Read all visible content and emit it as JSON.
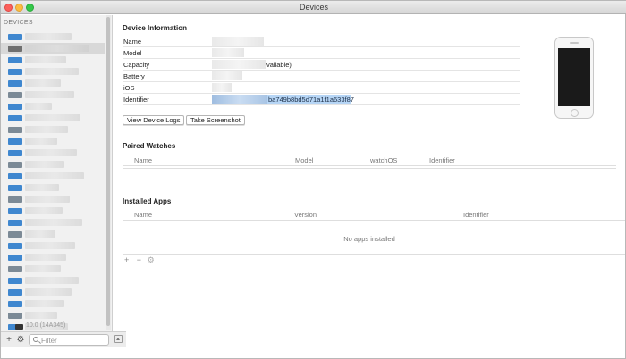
{
  "window": {
    "title": "Devices"
  },
  "sidebar": {
    "header": "DEVICES",
    "last_device_text": "10.0 (14A345)",
    "filter_placeholder": "Filter",
    "add_symbol": "+",
    "settings_symbol": "⚙"
  },
  "device_info": {
    "section_title": "Device Information",
    "rows": [
      {
        "label": "Name",
        "value": ""
      },
      {
        "label": "Model",
        "value": ""
      },
      {
        "label": "Capacity",
        "value": "vailable)"
      },
      {
        "label": "Battery",
        "value": ""
      },
      {
        "label": "iOS",
        "value": ""
      },
      {
        "label": "Identifier",
        "value": "ba749b8bd5d71a1f1a633f87"
      }
    ],
    "view_logs_button": "View Device Logs",
    "screenshot_button": "Take Screenshot"
  },
  "paired_watches": {
    "section_title": "Paired Watches",
    "columns": [
      "Name",
      "Model",
      "watchOS",
      "Identifier"
    ]
  },
  "installed_apps": {
    "section_title": "Installed Apps",
    "columns": [
      "Name",
      "Version",
      "Identifier"
    ],
    "empty_message": "No apps installed",
    "add_symbol": "+",
    "remove_symbol": "−",
    "gear_symbol": "⚙"
  },
  "colors": {
    "selection_highlight": "#b6d5f5",
    "device_icon_blue": "#3f87cf",
    "device_icon_gray": "#7c8a96"
  },
  "device_list": [
    {
      "icon": "phone-icon",
      "icon_color": "#3f87cf"
    },
    {
      "icon": "phone-icon",
      "icon_color": "#6f6f6f"
    },
    {
      "icon": "phone-icon",
      "icon_color": "#3f87cf"
    },
    {
      "icon": "phone-icon",
      "icon_color": "#3f87cf"
    },
    {
      "icon": "phone-icon",
      "icon_color": "#3f87cf"
    },
    {
      "icon": "phone-icon",
      "icon_color": "#7c8a96"
    },
    {
      "icon": "phone-icon",
      "icon_color": "#3f87cf"
    },
    {
      "icon": "phone-icon",
      "icon_color": "#3f87cf"
    },
    {
      "icon": "phone-icon",
      "icon_color": "#7c8a96"
    },
    {
      "icon": "phone-icon",
      "icon_color": "#3f87cf"
    },
    {
      "icon": "phone-icon",
      "icon_color": "#3f87cf"
    },
    {
      "icon": "phone-icon",
      "icon_color": "#7c8a96"
    },
    {
      "icon": "phone-icon",
      "icon_color": "#3f87cf"
    },
    {
      "icon": "phone-icon",
      "icon_color": "#3f87cf"
    },
    {
      "icon": "phone-icon",
      "icon_color": "#7c8a96"
    },
    {
      "icon": "phone-icon",
      "icon_color": "#3f87cf"
    },
    {
      "icon": "phone-icon",
      "icon_color": "#3f87cf"
    },
    {
      "icon": "phone-icon",
      "icon_color": "#7c8a96"
    },
    {
      "icon": "phone-icon",
      "icon_color": "#3f87cf"
    },
    {
      "icon": "phone-icon",
      "icon_color": "#3f87cf"
    },
    {
      "icon": "phone-icon",
      "icon_color": "#7c8a96"
    },
    {
      "icon": "phone-icon",
      "icon_color": "#3f87cf"
    },
    {
      "icon": "phone-icon",
      "icon_color": "#3f87cf"
    },
    {
      "icon": "phone-icon",
      "icon_color": "#3f87cf"
    },
    {
      "icon": "phone-icon",
      "icon_color": "#7c8a96"
    },
    {
      "icon": "phone-icon",
      "icon_color": "#3f87cf"
    }
  ]
}
